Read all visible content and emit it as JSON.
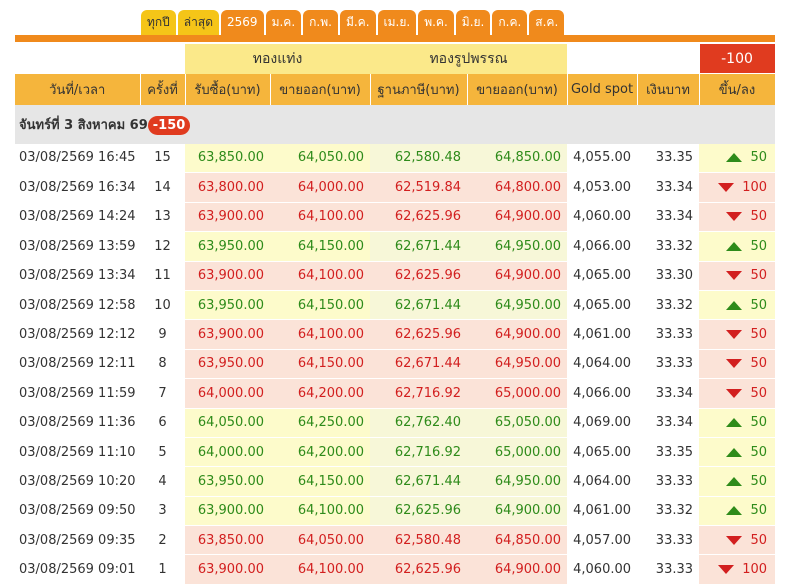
{
  "tabs": [
    "ทุกปี",
    "ล่าสุด",
    "2569",
    "ม.ค.",
    "ก.พ.",
    "มี.ค.",
    "เม.ย.",
    "พ.ค.",
    "มิ.ย.",
    "ก.ค.",
    "ส.ค."
  ],
  "active_tab": "2569",
  "header": {
    "group_bar": "ทองแท่ง",
    "group_ornament": "ทองรูปพรรณ",
    "change_total": "-100",
    "cols": [
      "วันที่/เวลา",
      "ครั้งที่",
      "รับซื้อ(บาท)",
      "ขายออก(บาท)",
      "ฐานภาษี(บาท)",
      "ขายออก(บาท)",
      "Gold spot",
      "เงินบาท",
      "ขึ้น/ลง"
    ]
  },
  "day": {
    "label": "จันทร์ที่ 3 สิงหาคม 69",
    "change": "-150"
  },
  "rows": [
    {
      "dt": "03/08/2569 16:45",
      "n": "15",
      "buy": "63,850.00",
      "sell": "64,050.00",
      "base": "62,580.48",
      "osell": "64,850.00",
      "spot": "4,055.00",
      "thb": "33.35",
      "dir": "up",
      "chg": "50"
    },
    {
      "dt": "03/08/2569 16:34",
      "n": "14",
      "buy": "63,800.00",
      "sell": "64,000.00",
      "base": "62,519.84",
      "osell": "64,800.00",
      "spot": "4,053.00",
      "thb": "33.34",
      "dir": "down",
      "chg": "100"
    },
    {
      "dt": "03/08/2569 14:24",
      "n": "13",
      "buy": "63,900.00",
      "sell": "64,100.00",
      "base": "62,625.96",
      "osell": "64,900.00",
      "spot": "4,060.00",
      "thb": "33.34",
      "dir": "down",
      "chg": "50"
    },
    {
      "dt": "03/08/2569 13:59",
      "n": "12",
      "buy": "63,950.00",
      "sell": "64,150.00",
      "base": "62,671.44",
      "osell": "64,950.00",
      "spot": "4,066.00",
      "thb": "33.32",
      "dir": "up",
      "chg": "50"
    },
    {
      "dt": "03/08/2569 13:34",
      "n": "11",
      "buy": "63,900.00",
      "sell": "64,100.00",
      "base": "62,625.96",
      "osell": "64,900.00",
      "spot": "4,065.00",
      "thb": "33.30",
      "dir": "down",
      "chg": "50"
    },
    {
      "dt": "03/08/2569 12:58",
      "n": "10",
      "buy": "63,950.00",
      "sell": "64,150.00",
      "base": "62,671.44",
      "osell": "64,950.00",
      "spot": "4,065.00",
      "thb": "33.32",
      "dir": "up",
      "chg": "50"
    },
    {
      "dt": "03/08/2569 12:12",
      "n": "9",
      "buy": "63,900.00",
      "sell": "64,100.00",
      "base": "62,625.96",
      "osell": "64,900.00",
      "spot": "4,061.00",
      "thb": "33.33",
      "dir": "down",
      "chg": "50"
    },
    {
      "dt": "03/08/2569 12:11",
      "n": "8",
      "buy": "63,950.00",
      "sell": "64,150.00",
      "base": "62,671.44",
      "osell": "64,950.00",
      "spot": "4,064.00",
      "thb": "33.33",
      "dir": "down",
      "chg": "50"
    },
    {
      "dt": "03/08/2569 11:59",
      "n": "7",
      "buy": "64,000.00",
      "sell": "64,200.00",
      "base": "62,716.92",
      "osell": "65,000.00",
      "spot": "4,066.00",
      "thb": "33.34",
      "dir": "down",
      "chg": "50"
    },
    {
      "dt": "03/08/2569 11:36",
      "n": "6",
      "buy": "64,050.00",
      "sell": "64,250.00",
      "base": "62,762.40",
      "osell": "65,050.00",
      "spot": "4,069.00",
      "thb": "33.34",
      "dir": "up",
      "chg": "50"
    },
    {
      "dt": "03/08/2569 11:10",
      "n": "5",
      "buy": "64,000.00",
      "sell": "64,200.00",
      "base": "62,716.92",
      "osell": "65,000.00",
      "spot": "4,065.00",
      "thb": "33.35",
      "dir": "up",
      "chg": "50"
    },
    {
      "dt": "03/08/2569 10:20",
      "n": "4",
      "buy": "63,950.00",
      "sell": "64,150.00",
      "base": "62,671.44",
      "osell": "64,950.00",
      "spot": "4,064.00",
      "thb": "33.33",
      "dir": "up",
      "chg": "50"
    },
    {
      "dt": "03/08/2569 09:50",
      "n": "3",
      "buy": "63,900.00",
      "sell": "64,100.00",
      "base": "62,625.96",
      "osell": "64,900.00",
      "spot": "4,061.00",
      "thb": "33.32",
      "dir": "up",
      "chg": "50"
    },
    {
      "dt": "03/08/2569 09:35",
      "n": "2",
      "buy": "63,850.00",
      "sell": "64,050.00",
      "base": "62,580.48",
      "osell": "64,850.00",
      "spot": "4,057.00",
      "thb": "33.33",
      "dir": "down",
      "chg": "50"
    },
    {
      "dt": "03/08/2569 09:01",
      "n": "1",
      "buy": "63,900.00",
      "sell": "64,100.00",
      "base": "62,625.96",
      "osell": "64,900.00",
      "spot": "4,060.00",
      "thb": "33.33",
      "dir": "down",
      "chg": "100"
    }
  ],
  "colors": {
    "accent_orange": "#f08a1c",
    "tab_yellow": "#f5c518",
    "header_orange": "#f5b53c",
    "up_green": "#2e8b1a",
    "down_red": "#d21f1f",
    "badge_red": "#e03b1f"
  }
}
